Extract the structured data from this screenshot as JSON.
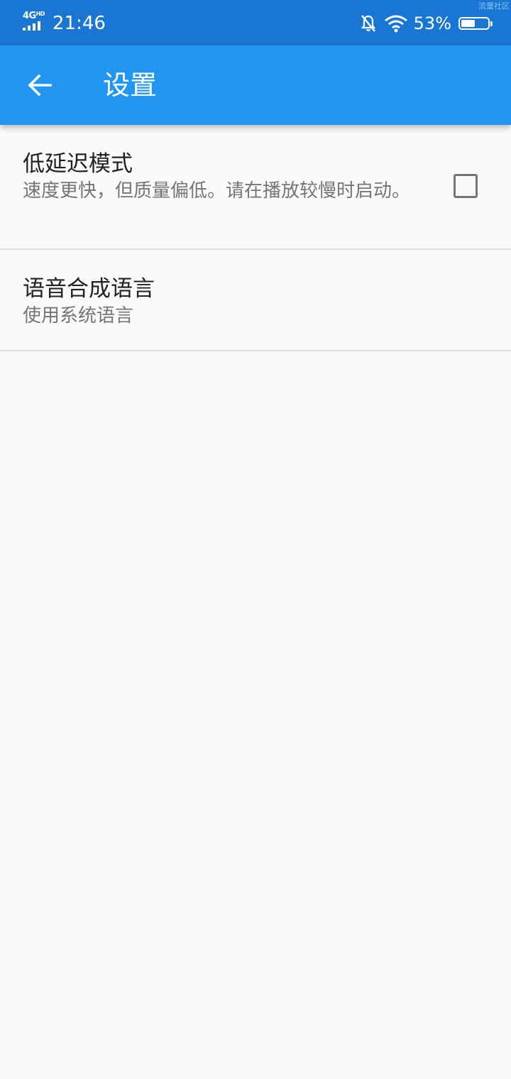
{
  "status_bar": {
    "network": "4G",
    "network_suffix": "HD",
    "time": "21:46",
    "watermark": "流量社区",
    "battery_percent": "53%",
    "battery_level": 0.53,
    "icons": [
      "signal-icon",
      "bell-off-icon",
      "wifi-icon",
      "battery-icon"
    ]
  },
  "app_bar": {
    "back_icon": "arrow-back-icon",
    "title": "设置",
    "color": "#2196f3"
  },
  "settings": {
    "items": [
      {
        "title": "低延迟模式",
        "summary": "速度更快，但质量偏低。请在播放较慢时启动。",
        "checked": false
      },
      {
        "title": "语音合成语言",
        "summary": "使用系统语言"
      }
    ]
  }
}
